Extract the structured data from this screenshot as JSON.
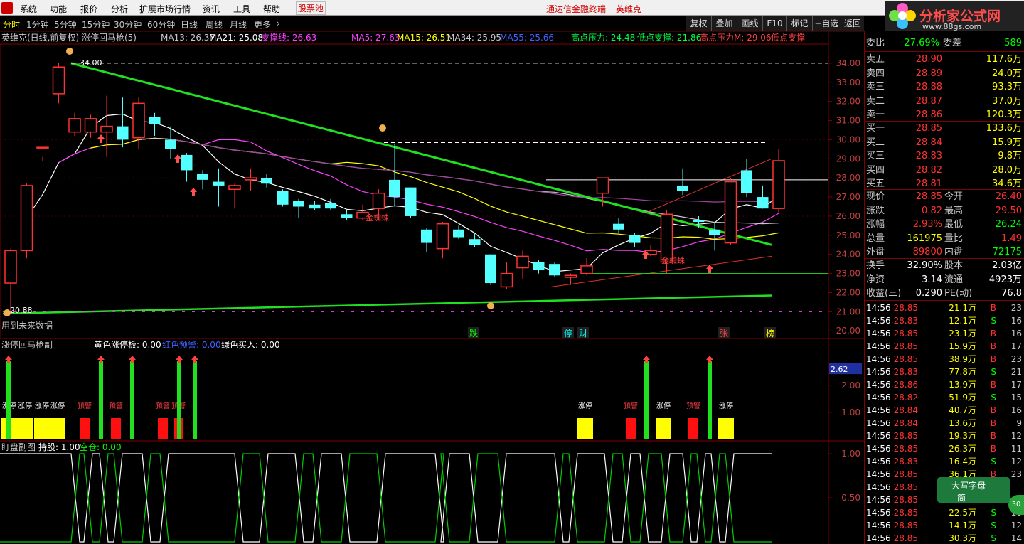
{
  "colors": {
    "up": "#ff3232",
    "down": "#54ffff",
    "green": "#00d000",
    "yellow": "#ffff00",
    "white": "#ffffff",
    "magenta": "#ff00ff",
    "grey": "#808080"
  },
  "menu": {
    "items": [
      "系统",
      "功能",
      "报价",
      "分析",
      "扩展市场行情",
      "资讯",
      "工具",
      "帮助"
    ],
    "stock_pool": "股票池",
    "center_title": "通达信金融终端",
    "stock_name": "英维克"
  },
  "brand": {
    "name": "分析家公式网",
    "url": "www.88gs.com"
  },
  "toolbar": {
    "periods": [
      "分时",
      "1分钟",
      "5分钟",
      "15分钟",
      "30分钟",
      "60分钟",
      "日线",
      "周线",
      "月线",
      "更多"
    ],
    "more_arrow": "›",
    "buttons": [
      "复权",
      "叠加",
      "画线",
      "F10",
      "标记",
      "+自选",
      "返回"
    ]
  },
  "main_legend": {
    "title": "英维克(日线,前复权) 涨停回马枪(5)",
    "ma13": "MA13: 26.37",
    "ma21": "MA21: 25.08",
    "support": "支撑线: 26.63",
    "ma5": "MA5: 27.63",
    "ma15": "MA15: 26.51",
    "ma34": "MA34: 25.95",
    "ma55": "MA55: 25.66",
    "high_press": "高点压力: 24.48",
    "low_sup": "低点支撑: 21.86",
    "high_press_m": "高点压力M: 29.06",
    "low_sup2": "低点支撑"
  },
  "price_axis": [
    "34.00",
    "33.00",
    "32.00",
    "31.00",
    "30.00",
    "29.00",
    "28.00",
    "27.00",
    "26.00",
    "25.00",
    "24.00",
    "23.00",
    "22.00",
    "21.00",
    "20.00"
  ],
  "chart_labels": {
    "high_label": "34.00",
    "low_label": "20.88",
    "future_note": "用到未来数据",
    "golden_spider": "金蜘蛛",
    "bottom_marks": [
      "跌",
      "停",
      "财",
      "张",
      "榜"
    ]
  },
  "sub1": {
    "title": "涨停回马枪副",
    "yellow_board": "黄色涨停板: 0.00",
    "red_warn": "红色预警: 0.00",
    "green_buy": "绿色买入: 0.00",
    "axis": [
      "2.00",
      "1.00"
    ],
    "current": "2.62",
    "zt_label": "涨停",
    "warn_label": "预警"
  },
  "sub2": {
    "title": "盯盘副图",
    "hold": "持股: 1.00",
    "empty": "空仓: 0.00",
    "axis": [
      "1.00",
      "0.50"
    ]
  },
  "quote": {
    "weibi_label": "委比",
    "weibi_value": "-27.69%",
    "weicha_label": "委差",
    "weicha_value": "-589",
    "asks": [
      {
        "label": "卖五",
        "price": "28.90",
        "vol": "117.6万"
      },
      {
        "label": "卖四",
        "price": "28.89",
        "vol": "24.0万"
      },
      {
        "label": "卖三",
        "price": "28.88",
        "vol": "93.3万"
      },
      {
        "label": "卖二",
        "price": "28.87",
        "vol": "37.0万"
      },
      {
        "label": "卖一",
        "price": "28.86",
        "vol": "120.3万"
      }
    ],
    "bids": [
      {
        "label": "买一",
        "price": "28.85",
        "vol": "133.6万"
      },
      {
        "label": "买二",
        "price": "28.84",
        "vol": "15.9万"
      },
      {
        "label": "买三",
        "price": "28.83",
        "vol": "9.8万"
      },
      {
        "label": "买四",
        "price": "28.82",
        "vol": "28.0万"
      },
      {
        "label": "买五",
        "price": "28.81",
        "vol": "34.6万"
      }
    ],
    "stats": [
      {
        "l1": "现价",
        "v1": "28.85",
        "l2": "今开",
        "v2": "26.40"
      },
      {
        "l1": "涨跌",
        "v1": "0.82",
        "l2": "最高",
        "v2": "29.50"
      },
      {
        "l1": "涨幅",
        "v1": "2.93%",
        "l2": "最低",
        "v2": "26.24"
      },
      {
        "l1": "总量",
        "v1": "161975",
        "l2": "量比",
        "v2": "1.49"
      },
      {
        "l1": "外盘",
        "v1": "89800",
        "l2": "内盘",
        "v2": "72175"
      }
    ],
    "finance": [
      {
        "l1": "换手",
        "v1": "32.90%",
        "l2": "股本",
        "v2": "2.03亿"
      },
      {
        "l1": "净资",
        "v1": "3.14",
        "l2": "流通",
        "v2": "4923万"
      },
      {
        "l1": "收益(三)",
        "v1": "0.290",
        "l2": "PE(动)",
        "v2": "76.8"
      }
    ]
  },
  "ticks": [
    {
      "t": "14:56",
      "p": "28.85",
      "v": "21.1万",
      "bs": "B",
      "n": "23"
    },
    {
      "t": "14:56",
      "p": "28.83",
      "v": "12.1万",
      "bs": "S",
      "n": "16"
    },
    {
      "t": "14:56",
      "p": "28.85",
      "v": "23.1万",
      "bs": "B",
      "n": "16"
    },
    {
      "t": "14:56",
      "p": "28.85",
      "v": "15.9万",
      "bs": "B",
      "n": "17"
    },
    {
      "t": "14:56",
      "p": "28.85",
      "v": "38.9万",
      "bs": "B",
      "n": "23"
    },
    {
      "t": "14:56",
      "p": "28.83",
      "v": "77.8万",
      "bs": "S",
      "n": "21"
    },
    {
      "t": "14:56",
      "p": "28.86",
      "v": "13.9万",
      "bs": "B",
      "n": "17"
    },
    {
      "t": "14:56",
      "p": "28.82",
      "v": "51.9万",
      "bs": "S",
      "n": "15"
    },
    {
      "t": "14:56",
      "p": "28.84",
      "v": "40.7万",
      "bs": "B",
      "n": "16"
    },
    {
      "t": "14:56",
      "p": "28.84",
      "v": "13.6万",
      "bs": "B",
      "n": "9"
    },
    {
      "t": "14:56",
      "p": "28.85",
      "v": "19.3万",
      "bs": "B",
      "n": "12"
    },
    {
      "t": "14:56",
      "p": "28.85",
      "v": "26.3万",
      "bs": "B",
      "n": "11"
    },
    {
      "t": "14:56",
      "p": "28.83",
      "v": "16.4万",
      "bs": "S",
      "n": "12"
    },
    {
      "t": "14:56",
      "p": "28.85",
      "v": "36.1万",
      "bs": "B",
      "n": "23"
    },
    {
      "t": "14:56",
      "p": "28.85",
      "v": "",
      "bs": "",
      "n": ""
    },
    {
      "t": "14:56",
      "p": "28.85",
      "v": "",
      "bs": "",
      "n": ""
    },
    {
      "t": "14:56",
      "p": "28.85",
      "v": "22.5万",
      "bs": "S",
      "n": "16"
    },
    {
      "t": "14:56",
      "p": "28.85",
      "v": "14.1万",
      "bs": "S",
      "n": "12"
    },
    {
      "t": "14:56",
      "p": "28.85",
      "v": "30.3万",
      "bs": "S",
      "n": "14"
    }
  ],
  "ime": {
    "mode": "大写字母",
    "lang": "简"
  },
  "badge30": "30",
  "chart_data": {
    "type": "candlestick",
    "ylim": [
      19.6,
      35.0
    ],
    "candles": [
      [
        22.5,
        24.2,
        20.9,
        24.3
      ],
      [
        24.2,
        27.6,
        23.8,
        27.7
      ],
      [
        29.6,
        29.6,
        28.9,
        29.1
      ],
      [
        32.4,
        33.8,
        31.9,
        34.0
      ],
      [
        30.4,
        31.1,
        30.2,
        31.4
      ],
      [
        30.4,
        31.1,
        30.1,
        31.3
      ],
      [
        30.4,
        30.7,
        29.1,
        32.3
      ],
      [
        30.7,
        30.0,
        29.6,
        32.2
      ],
      [
        30.1,
        31.9,
        29.5,
        32.2
      ],
      [
        31.2,
        30.8,
        30.2,
        31.4
      ],
      [
        30.0,
        29.5,
        29.0,
        30.7
      ],
      [
        29.2,
        28.4,
        27.8,
        29.3
      ],
      [
        28.2,
        27.9,
        27.4,
        28.4
      ],
      [
        27.8,
        27.6,
        26.5,
        28.5
      ],
      [
        27.4,
        27.6,
        26.4,
        27.7
      ],
      [
        27.9,
        28.0,
        27.3,
        28.5
      ],
      [
        28.0,
        27.7,
        27.5,
        28.2
      ],
      [
        27.3,
        26.6,
        26.5,
        27.4
      ],
      [
        26.8,
        26.5,
        25.9,
        26.9
      ],
      [
        26.6,
        26.4,
        26.3,
        26.8
      ],
      [
        26.7,
        26.4,
        26.3,
        26.9
      ],
      [
        26.1,
        25.9,
        25.8,
        26.3
      ],
      [
        25.9,
        26.2,
        25.8,
        26.6
      ],
      [
        26.4,
        27.2,
        25.8,
        27.4
      ],
      [
        27.9,
        27.0,
        26.5,
        29.8
      ],
      [
        27.5,
        26.0,
        25.9,
        27.5
      ],
      [
        25.3,
        24.6,
        24.1,
        25.4
      ],
      [
        24.3,
        25.6,
        23.8,
        25.7
      ],
      [
        25.3,
        24.9,
        24.8,
        25.5
      ],
      [
        24.8,
        24.5,
        24.4,
        25.1
      ],
      [
        24.0,
        22.5,
        22.4,
        24.0
      ],
      [
        22.3,
        23.0,
        22.2,
        23.6
      ],
      [
        23.3,
        23.9,
        22.7,
        24.2
      ],
      [
        23.6,
        23.2,
        23.0,
        23.7
      ],
      [
        23.5,
        22.9,
        22.8,
        23.6
      ],
      [
        22.8,
        22.9,
        22.4,
        23.0
      ],
      [
        23.0,
        23.4,
        22.9,
        23.8
      ],
      [
        27.2,
        28.0,
        26.5,
        28.0
      ],
      [
        25.6,
        25.3,
        25.1,
        25.9
      ],
      [
        25.0,
        24.6,
        24.4,
        25.1
      ],
      [
        24.0,
        24.2,
        23.9,
        24.5
      ],
      [
        23.6,
        26.1,
        23.0,
        26.3
      ],
      [
        27.6,
        27.3,
        27.1,
        28.5
      ],
      [
        25.8,
        25.7,
        25.4,
        26.0
      ],
      [
        25.3,
        25.0,
        24.2,
        25.7
      ],
      [
        24.6,
        27.8,
        24.5,
        28.0
      ],
      [
        28.4,
        27.2,
        27.0,
        29.0
      ],
      [
        27.0,
        26.4,
        26.4,
        27.6
      ],
      [
        26.4,
        28.9,
        26.2,
        29.5
      ]
    ]
  }
}
